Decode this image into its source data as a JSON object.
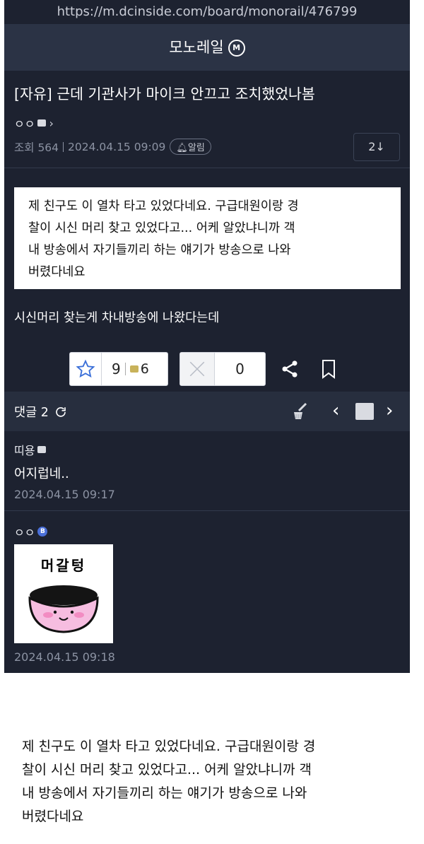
{
  "browser": {
    "url": "https://m.dcinside.com/board/monorail/476799"
  },
  "gallery": {
    "title": "모노레일",
    "badge": "M"
  },
  "post": {
    "title": "[자유] 근데 기관사가 마이크 안끄고 조치했었나봄",
    "author": "ㅇㅇ",
    "views": "조회 564",
    "date": "2024.04.15 09:09",
    "alarm_label": "알림",
    "comment_button": "2↓",
    "quote_lines": [
      "제 친구도 이 열차 타고 있었다네요. 구급대원이랑 경",
      "찰이 시신 머리 찾고 있었다고... 어케 알았냐니까 객",
      "내 방송에서 자기들끼리 하는 얘기가 방송으로 나와",
      "버렸다네요"
    ],
    "body": "시신머리 찾는게 차내방송에 나왔다는데",
    "recommend_count": "9",
    "fixed_recommend_count": "6",
    "nonrecommend_count": "0"
  },
  "comments_bar": {
    "label": "댓글 2"
  },
  "comments": [
    {
      "nick": "띠용",
      "text": "어지럽네..",
      "date": "2024.04.15 09:17"
    },
    {
      "nick": "ㅇㅇ",
      "badge": "B",
      "dccon_text": "머갈텅",
      "date": "2024.04.15 09:18"
    }
  ],
  "bottom_quote_lines": [
    "제 친구도 이 열차 타고 있었다네요. 구급대원이랑 경",
    "찰이 시신 머리 찾고 있었다고... 어케 알았냐니까 객",
    "내 방송에서 자기들끼리 하는 얘기가 방송으로 나와",
    "버렸다네요"
  ]
}
